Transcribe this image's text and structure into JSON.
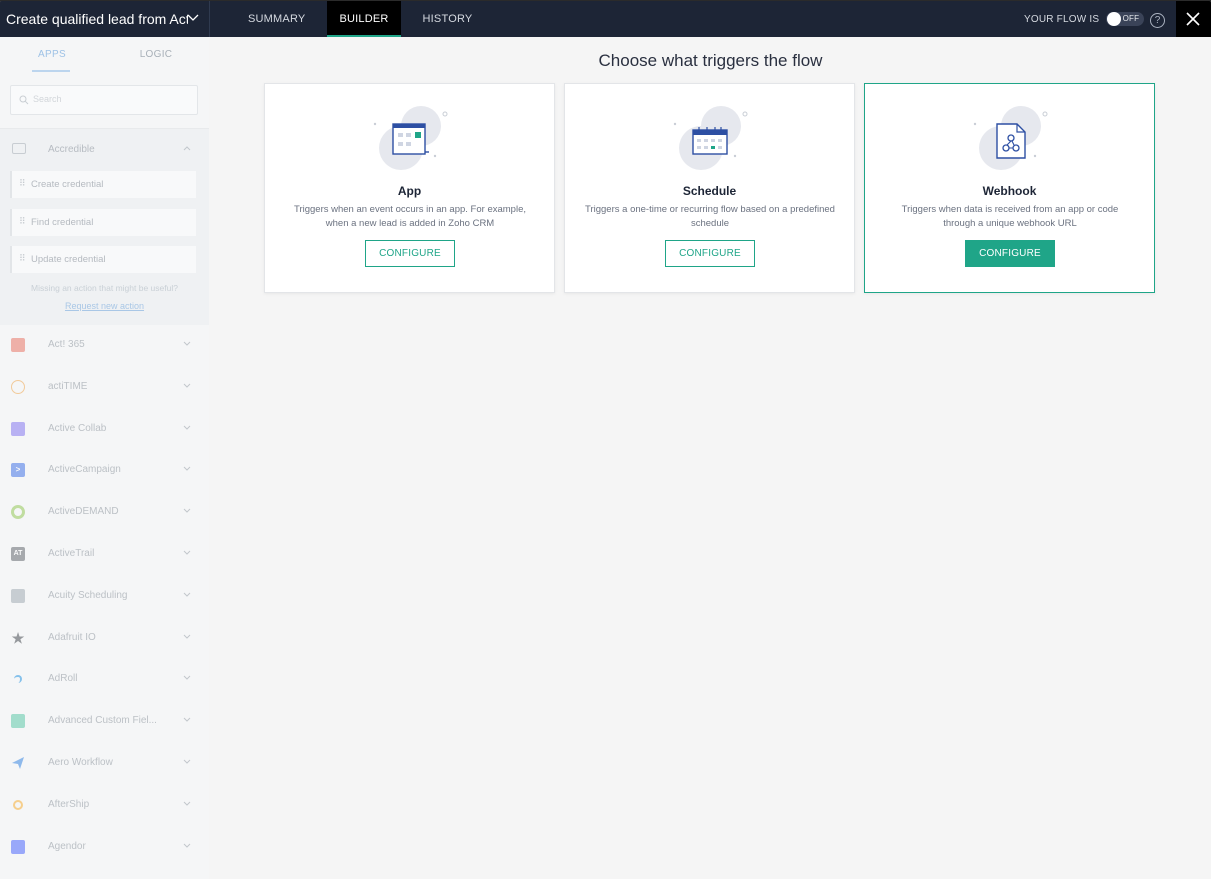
{
  "header": {
    "flow_title": "Create qualified lead from Act",
    "tabs": [
      {
        "label": "SUMMARY",
        "active": false
      },
      {
        "label": "BUILDER",
        "active": true
      },
      {
        "label": "HISTORY",
        "active": false
      }
    ],
    "flow_status_label": "YOUR FLOW IS",
    "toggle_state": "OFF",
    "help_symbol": "?"
  },
  "sidebar": {
    "tabs": [
      {
        "label": "APPS",
        "active": true
      },
      {
        "label": "LOGIC",
        "active": false
      }
    ],
    "search_placeholder": "Search",
    "expanded_app": {
      "name": "Accredible",
      "actions": [
        "Create credential",
        "Find credential",
        "Update credential"
      ],
      "missing_text": "Missing an action that might be useful?",
      "request_link": "Request new action"
    },
    "apps": [
      {
        "name": "Act! 365",
        "color": "#e86a5a",
        "glyph": ""
      },
      {
        "name": "actiTIME",
        "color": "#f0a040",
        "glyph": ""
      },
      {
        "name": "Active Collab",
        "color": "#7b6cf0",
        "glyph": ""
      },
      {
        "name": "ActiveCampaign",
        "color": "#356ae6",
        "glyph": ">"
      },
      {
        "name": "ActiveDEMAND",
        "color": "#8bc34a",
        "glyph": ""
      },
      {
        "name": "ActiveTrail",
        "color": "#5a5f66",
        "glyph": "AT"
      },
      {
        "name": "Acuity Scheduling",
        "color": "#9aa3ad",
        "glyph": ""
      },
      {
        "name": "Adafruit IO",
        "color": "#3a3f45",
        "glyph": "★"
      },
      {
        "name": "AdRoll",
        "color": "#1a8ee0",
        "glyph": ""
      },
      {
        "name": "Advanced Custom Fiel...",
        "color": "#4fc3a1",
        "glyph": ""
      },
      {
        "name": "Aero Workflow",
        "color": "#2a7de1",
        "glyph": ""
      },
      {
        "name": "AfterShip",
        "color": "#f7a823",
        "glyph": ""
      },
      {
        "name": "Agendor",
        "color": "#3d5afe",
        "glyph": ""
      }
    ]
  },
  "main": {
    "heading": "Choose what triggers the flow",
    "cards": [
      {
        "title": "App",
        "description": "Triggers when an event occurs in an app. For example, when a new lead is added in Zoho CRM",
        "button": "CONFIGURE",
        "selected": false,
        "icon": "app-window-icon"
      },
      {
        "title": "Schedule",
        "description": "Triggers a one-time or recurring flow based on a predefined schedule",
        "button": "CONFIGURE",
        "selected": false,
        "icon": "calendar-icon"
      },
      {
        "title": "Webhook",
        "description": "Triggers when data is received from an app or code through a unique webhook URL",
        "button": "CONFIGURE",
        "selected": true,
        "icon": "webhook-icon"
      }
    ]
  },
  "colors": {
    "topbar": "#1d2536",
    "accent": "#1fa588",
    "illustration_blue": "#2d4fa3"
  }
}
